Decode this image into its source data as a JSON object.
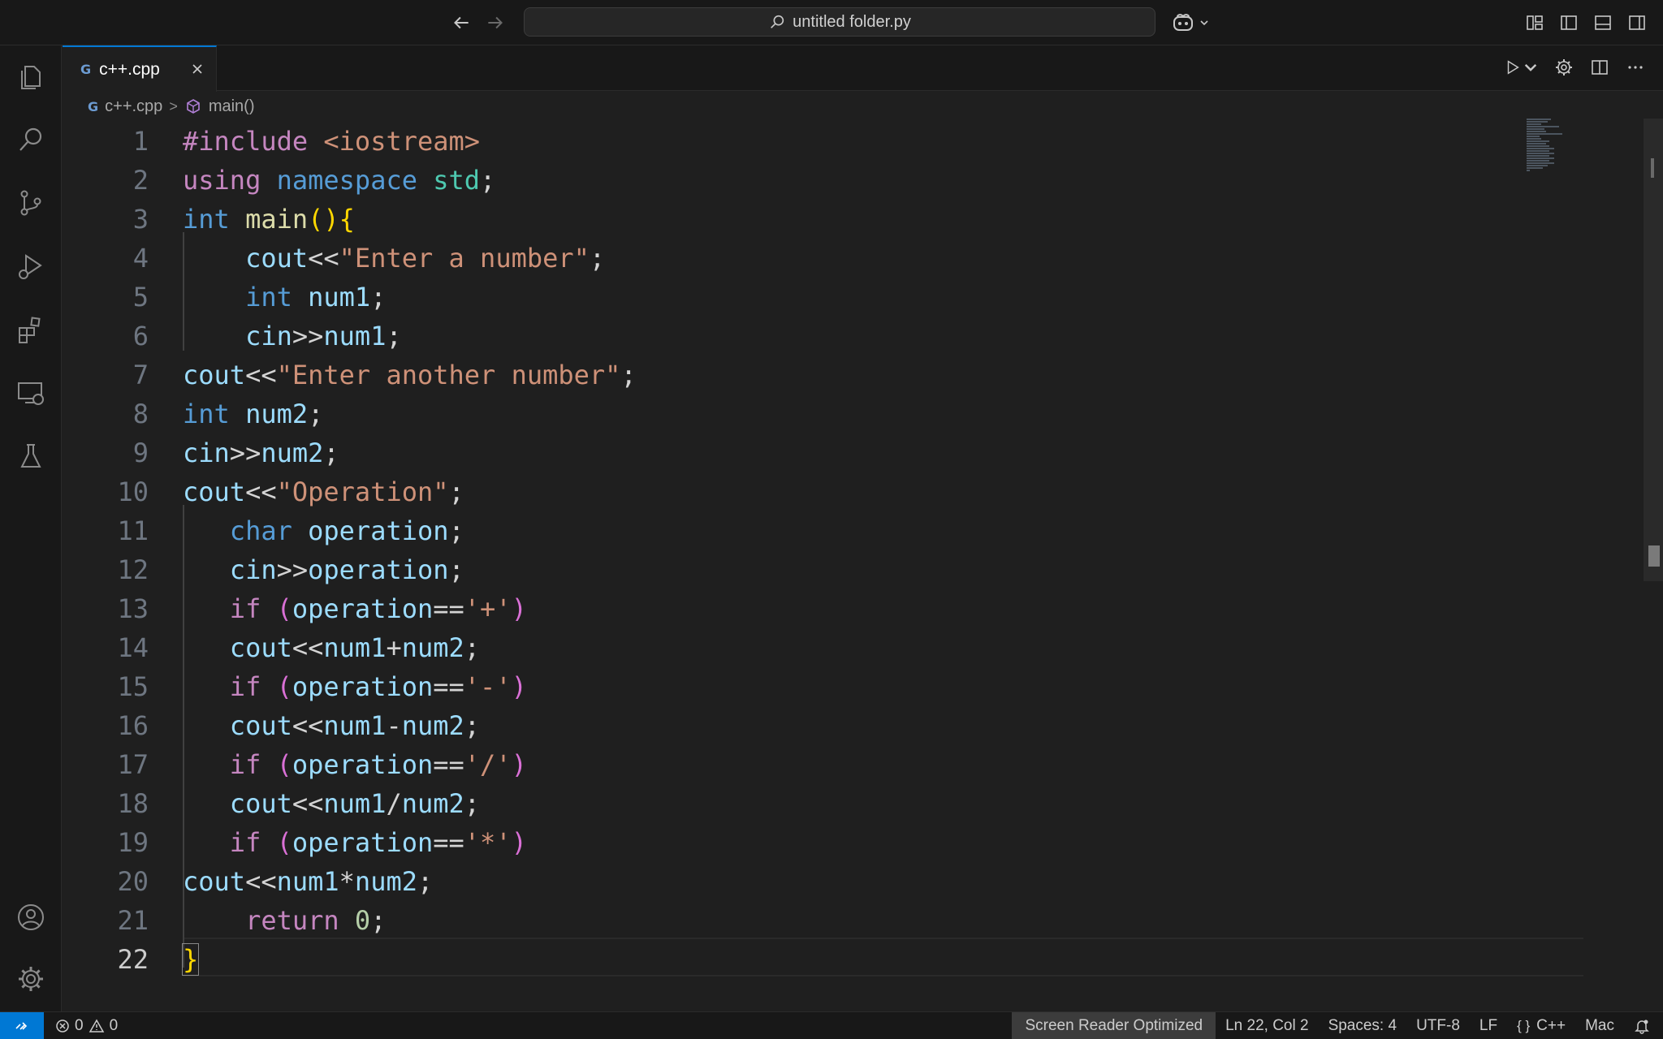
{
  "titlebar": {
    "search_text": "untitled folder.py"
  },
  "tab": {
    "icon_text": "G",
    "label": "c++.cpp"
  },
  "breadcrumb": {
    "file": "c++.cpp",
    "separator": ">",
    "symbol": "main()"
  },
  "editor": {
    "lines": [
      {
        "n": "1"
      },
      {
        "n": "2"
      },
      {
        "n": "3"
      },
      {
        "n": "4"
      },
      {
        "n": "5"
      },
      {
        "n": "6"
      },
      {
        "n": "7"
      },
      {
        "n": "8"
      },
      {
        "n": "9"
      },
      {
        "n": "10"
      },
      {
        "n": "11"
      },
      {
        "n": "12"
      },
      {
        "n": "13"
      },
      {
        "n": "14"
      },
      {
        "n": "15"
      },
      {
        "n": "16"
      },
      {
        "n": "17"
      },
      {
        "n": "18"
      },
      {
        "n": "19"
      },
      {
        "n": "20"
      },
      {
        "n": "21"
      },
      {
        "n": "22"
      }
    ],
    "code": [
      [
        [
          "dir",
          "#include "
        ],
        [
          "str",
          "<iostream>"
        ]
      ],
      [
        [
          "ctl",
          "using"
        ],
        [
          "op",
          " "
        ],
        [
          "kw",
          "namespace"
        ],
        [
          "op",
          " "
        ],
        [
          "ns",
          "std"
        ],
        [
          "op",
          ";"
        ]
      ],
      [
        [
          "kw",
          "int"
        ],
        [
          "op",
          " "
        ],
        [
          "fn",
          "main"
        ],
        [
          "br",
          "()"
        ],
        [
          "br",
          "{"
        ]
      ],
      [
        [
          "op",
          "    "
        ],
        [
          "var",
          "cout"
        ],
        [
          "op",
          "<<"
        ],
        [
          "str",
          "\"Enter a number\""
        ],
        [
          "op",
          ";"
        ]
      ],
      [
        [
          "op",
          "    "
        ],
        [
          "kw",
          "int"
        ],
        [
          "op",
          " "
        ],
        [
          "var",
          "num1"
        ],
        [
          "op",
          ";"
        ]
      ],
      [
        [
          "op",
          "    "
        ],
        [
          "var",
          "cin"
        ],
        [
          "op",
          ">>"
        ],
        [
          "var",
          "num1"
        ],
        [
          "op",
          ";"
        ]
      ],
      [
        [
          "var",
          "cout"
        ],
        [
          "op",
          "<<"
        ],
        [
          "str",
          "\"Enter another number\""
        ],
        [
          "op",
          ";"
        ]
      ],
      [
        [
          "kw",
          "int"
        ],
        [
          "op",
          " "
        ],
        [
          "var",
          "num2"
        ],
        [
          "op",
          ";"
        ]
      ],
      [
        [
          "var",
          "cin"
        ],
        [
          "op",
          ">>"
        ],
        [
          "var",
          "num2"
        ],
        [
          "op",
          ";"
        ]
      ],
      [
        [
          "var",
          "cout"
        ],
        [
          "op",
          "<<"
        ],
        [
          "str",
          "\"Operation\""
        ],
        [
          "op",
          ";"
        ]
      ],
      [
        [
          "op",
          "   "
        ],
        [
          "kw",
          "char"
        ],
        [
          "op",
          " "
        ],
        [
          "var",
          "operation"
        ],
        [
          "op",
          ";"
        ]
      ],
      [
        [
          "op",
          "   "
        ],
        [
          "var",
          "cin"
        ],
        [
          "op",
          ">>"
        ],
        [
          "var",
          "operation"
        ],
        [
          "op",
          ";"
        ]
      ],
      [
        [
          "op",
          "   "
        ],
        [
          "ctl",
          "if"
        ],
        [
          "op",
          " "
        ],
        [
          "br2",
          "("
        ],
        [
          "var",
          "operation"
        ],
        [
          "op",
          "=="
        ],
        [
          "str",
          "'+'"
        ],
        [
          "br2",
          ")"
        ]
      ],
      [
        [
          "op",
          "   "
        ],
        [
          "var",
          "cout"
        ],
        [
          "op",
          "<<"
        ],
        [
          "var",
          "num1"
        ],
        [
          "op",
          "+"
        ],
        [
          "var",
          "num2"
        ],
        [
          "op",
          ";"
        ]
      ],
      [
        [
          "op",
          "   "
        ],
        [
          "ctl",
          "if"
        ],
        [
          "op",
          " "
        ],
        [
          "br2",
          "("
        ],
        [
          "var",
          "operation"
        ],
        [
          "op",
          "=="
        ],
        [
          "str",
          "'-'"
        ],
        [
          "br2",
          ")"
        ]
      ],
      [
        [
          "op",
          "   "
        ],
        [
          "var",
          "cout"
        ],
        [
          "op",
          "<<"
        ],
        [
          "var",
          "num1"
        ],
        [
          "op",
          "-"
        ],
        [
          "var",
          "num2"
        ],
        [
          "op",
          ";"
        ]
      ],
      [
        [
          "op",
          "   "
        ],
        [
          "ctl",
          "if"
        ],
        [
          "op",
          " "
        ],
        [
          "br2",
          "("
        ],
        [
          "var",
          "operation"
        ],
        [
          "op",
          "=="
        ],
        [
          "str",
          "'/'"
        ],
        [
          "br2",
          ")"
        ]
      ],
      [
        [
          "op",
          "   "
        ],
        [
          "var",
          "cout"
        ],
        [
          "op",
          "<<"
        ],
        [
          "var",
          "num1"
        ],
        [
          "op",
          "/"
        ],
        [
          "var",
          "num2"
        ],
        [
          "op",
          ";"
        ]
      ],
      [
        [
          "op",
          "   "
        ],
        [
          "ctl",
          "if"
        ],
        [
          "op",
          " "
        ],
        [
          "br2",
          "("
        ],
        [
          "var",
          "operation"
        ],
        [
          "op",
          "=="
        ],
        [
          "str",
          "'*'"
        ],
        [
          "br2",
          ")"
        ]
      ],
      [
        [
          "var",
          "cout"
        ],
        [
          "op",
          "<<"
        ],
        [
          "var",
          "num1"
        ],
        [
          "op",
          "*"
        ],
        [
          "var",
          "num2"
        ],
        [
          "op",
          ";"
        ]
      ],
      [
        [
          "op",
          "    "
        ],
        [
          "ctl",
          "return"
        ],
        [
          "op",
          " "
        ],
        [
          "num",
          "0"
        ],
        [
          "op",
          ";"
        ]
      ],
      [
        [
          "brc",
          "}"
        ]
      ]
    ],
    "active_line": "22"
  },
  "statusbar": {
    "errors": "0",
    "warnings": "0",
    "screen_reader": "Screen Reader Optimized",
    "position": "Ln 22, Col 2",
    "spaces": "Spaces: 4",
    "encoding": "UTF-8",
    "eol": "LF",
    "lang_icon": "{ }",
    "language": "C++",
    "keymap": "Mac"
  },
  "icons": {
    "activity": [
      "files-icon",
      "search-icon",
      "source-control-icon",
      "run-debug-icon",
      "extensions-icon",
      "remote-explorer-icon",
      "testing-icon",
      "account-icon",
      "settings-gear-icon"
    ]
  },
  "colors": {
    "accent": "#0078d4",
    "background": "#1f1f1f",
    "sidebar": "#181818"
  }
}
